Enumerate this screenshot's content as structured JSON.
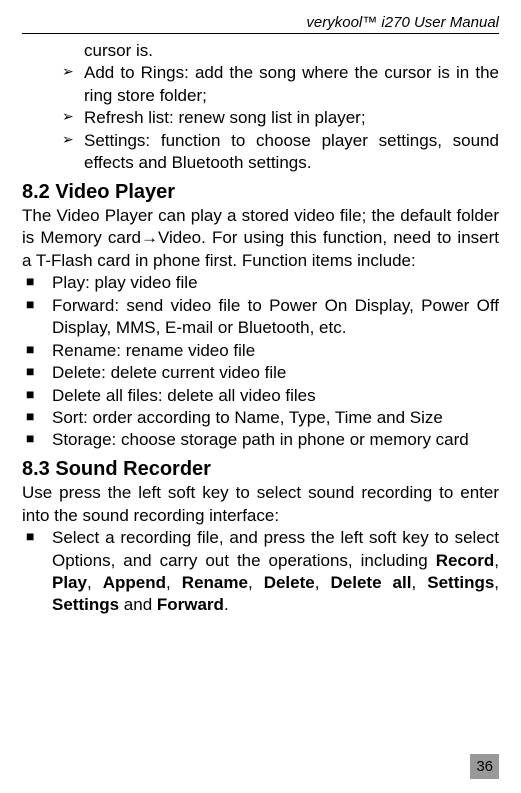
{
  "header": {
    "brand": "verykool",
    "tm": "™",
    "model": " i270 User Manual"
  },
  "cursor_line": "cursor is.",
  "chevrons": [
    "Add to Rings: add the song where the cursor is in the ring store folder;",
    "Refresh list: renew song list in player;",
    "Settings: function to choose player settings, sound effects and Bluetooth settings."
  ],
  "section_82": {
    "title": "8.2 Video Player",
    "para": "The Video Player can play a stored video file; the default folder is Memory card→Video. For using this function, need to insert a T-Flash card in phone first. Function items include:",
    "bullets": [
      "Play: play video file",
      "Forward: send video file to Power On Display, Power Off Display, MMS, E-mail or Bluetooth, etc.",
      "Rename: rename video file",
      "Delete: delete current video file",
      "Delete all files: delete all video files",
      "Sort: order according to Name, Type, Time and Size",
      "Storage: choose storage path in phone or memory card"
    ]
  },
  "section_83": {
    "title": "8.3 Sound Recorder",
    "para": "Use press the left soft key to select sound recording to enter into the sound recording interface:",
    "bullet_prefix": "Select a recording file, and press the left soft key to select Options, and carry out the operations, including ",
    "bold_parts": [
      "Record",
      "Play",
      "Append",
      "Rename",
      "Delete",
      "Delete all",
      "Settings",
      "Settings",
      "Forward"
    ],
    "separator": ", ",
    "and_word": " and ",
    "period": "."
  },
  "page_number": "36"
}
